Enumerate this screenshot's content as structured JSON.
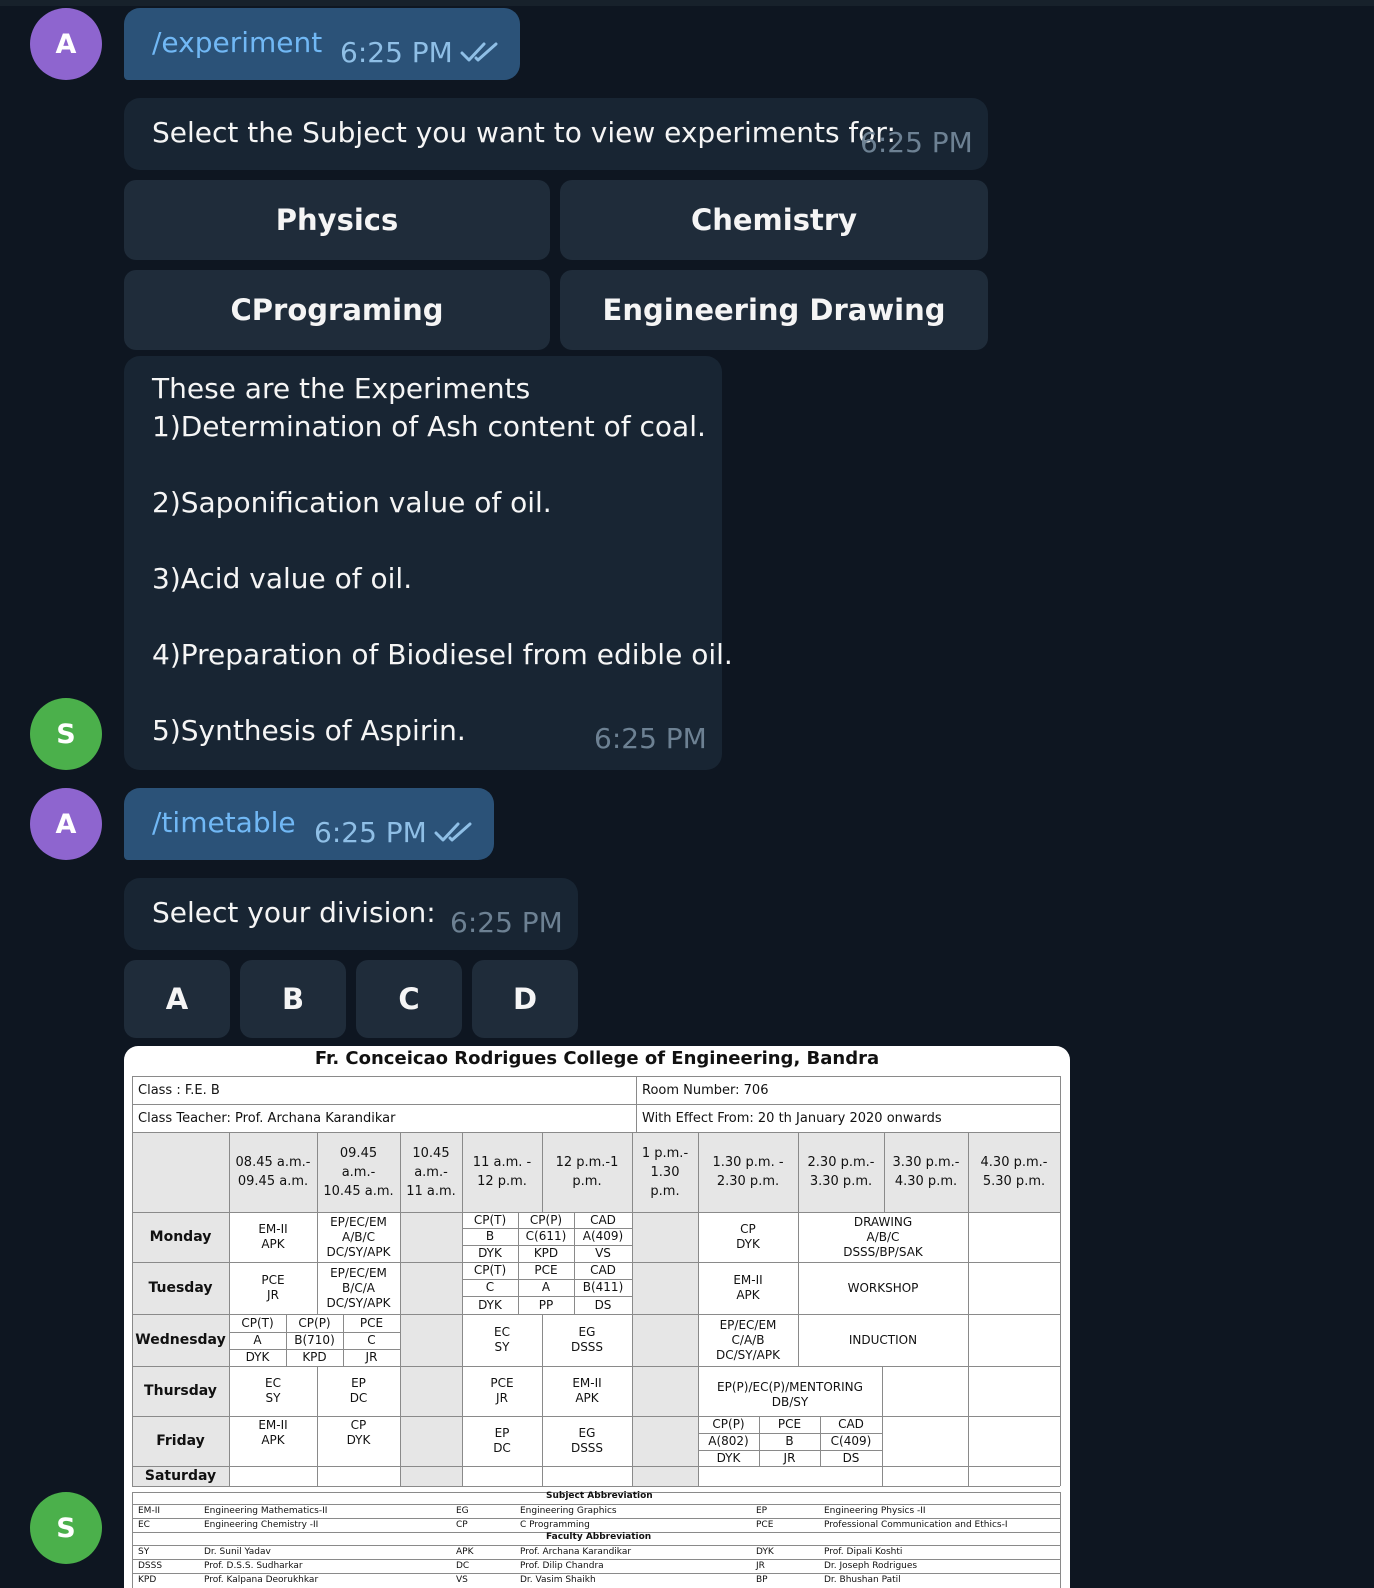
{
  "conversation": {
    "cmd1": {
      "avatar": "A",
      "text": "/experiment",
      "time": "6:25 PM"
    },
    "reply1": {
      "text": "Select the Subject you want to view experiments for:",
      "time": "6:25 PM"
    },
    "subjects": [
      "Physics",
      "Chemistry",
      "CPrograming",
      "Engineering Drawing"
    ],
    "experiments": {
      "avatar": "S",
      "heading": "These are the Experiments",
      "items": [
        "1)Determination of Ash content of coal.",
        "2)Saponification value of oil.",
        "3)Acid value of oil.",
        "4)Preparation of Biodiesel from edible oil.",
        "5)Synthesis of Aspirin."
      ],
      "time": "6:25 PM"
    },
    "cmd2": {
      "avatar": "A",
      "text": "/timetable",
      "time": "6:25 PM"
    },
    "reply2": {
      "text": "Select your division:",
      "time": "6:25 PM"
    },
    "divisions": [
      "A",
      "B",
      "C",
      "D"
    ],
    "photo_avatar": "S"
  },
  "timetable": {
    "title": "Fr. Conceicao Rodrigues College of Engineering, Bandra",
    "class": "Class : F.E.  B",
    "room": "Room Number: 706",
    "teacher": "Class Teacher: Prof. Archana Karandikar",
    "effect": "With Effect From:  20 th January 2020 onwards",
    "slots": [
      "08.45 a.m.-\n09.45 a.m.",
      "09.45\na.m.-\n10.45 a.m.",
      "10.45\na.m.-\n11 a.m.",
      "11 a.m. -\n12 p.m.",
      "12 p.m.-1\np.m.",
      "1 p.m.-\n1.30\np.m.",
      "1.30 p.m. -\n2.30 p.m.",
      "2.30 p.m.-\n3.30 p.m.",
      "3.30 p.m.-\n4.30 p.m.",
      "4.30 p.m.-\n5.30 p.m."
    ],
    "days": [
      "Monday",
      "Tuesday",
      "Wednesday",
      "Thursday",
      "Friday",
      "Saturday"
    ],
    "cells": {
      "mon_s1": "EM-II\nAPK",
      "mon_s2": "EP/EC/EM\nA/B/C\nDC/SY/APK",
      "mon_lab": [
        [
          "CP(T)",
          "CP(P)",
          "CAD"
        ],
        [
          "B",
          "C(611)",
          "A(409)"
        ],
        [
          "DYK",
          "KPD",
          "VS"
        ]
      ],
      "mon_cp": "CP\nDYK",
      "mon_drawing": "DRAWING\nA/B/C\nDSSS/BP/SAK",
      "tue_s1": "PCE\nJR",
      "tue_s2": "EP/EC/EM\nB/C/A\nDC/SY/APK",
      "tue_lab": [
        [
          "CP(T)",
          "PCE",
          "CAD"
        ],
        [
          "C",
          "A",
          "B(411)"
        ],
        [
          "DYK",
          "PP",
          "DS"
        ]
      ],
      "tue_em": "EM-II\nAPK",
      "tue_workshop": "WORKSHOP",
      "wed_lab": [
        [
          "CP(T)",
          "CP(P)",
          "PCE"
        ],
        [
          "A",
          "B(710)",
          "C"
        ],
        [
          "DYK",
          "KPD",
          "JR"
        ]
      ],
      "wed_ec": "EC\nSY",
      "wed_eg": "EG\nDSSS",
      "wed_ep": "EP/EC/EM\nC/A/B\nDC/SY/APK",
      "wed_induction": "INDUCTION",
      "thu_s1": "EC\nSY",
      "thu_s2": "EP\nDC",
      "thu_pce": "PCE\nJR",
      "thu_em": "EM-II\nAPK",
      "thu_mentoring": "EP(P)/EC(P)/MENTORING\nDB/SY",
      "fri_s1": "EM-II\nAPK",
      "fri_s2": "CP\nDYK",
      "fri_ep": "EP\nDC",
      "fri_eg": "EG\nDSSS",
      "fri_lab": [
        [
          "CP(P)",
          "PCE",
          "CAD"
        ],
        [
          "A(802)",
          "B",
          "C(409)"
        ],
        [
          "DYK",
          "JR",
          "DS"
        ]
      ]
    },
    "subject_abbreviation_title": "Subject Abbreviation",
    "subject_abbr": [
      [
        "EM-II",
        "Engineering Mathematics-II",
        "EG",
        "Engineering Graphics",
        "EP",
        "Engineering  Physics -II"
      ],
      [
        "EC",
        "Engineering Chemistry -II",
        "CP",
        "C Programming",
        "PCE",
        "Professional Communication and Ethics-I"
      ]
    ],
    "faculty_abbreviation_title": "Faculty Abbreviation",
    "faculty_abbr": [
      [
        "SY",
        "Dr. Sunil Yadav",
        "APK",
        "Prof. Archana Karandikar",
        "DYK",
        "Prof. Dipali Koshti"
      ],
      [
        "DSSS",
        "Prof. D.S.S. Sudharkar",
        "DC",
        "Prof. Dilip Chandra",
        "JR",
        "Dr. Joseph Rodrigues"
      ],
      [
        "KPD",
        "Prof. Kalpana Deorukhkar",
        "VS",
        "Dr. Vasim Shaikh",
        "BP",
        "Dr. Bhushan Patil"
      ]
    ]
  }
}
